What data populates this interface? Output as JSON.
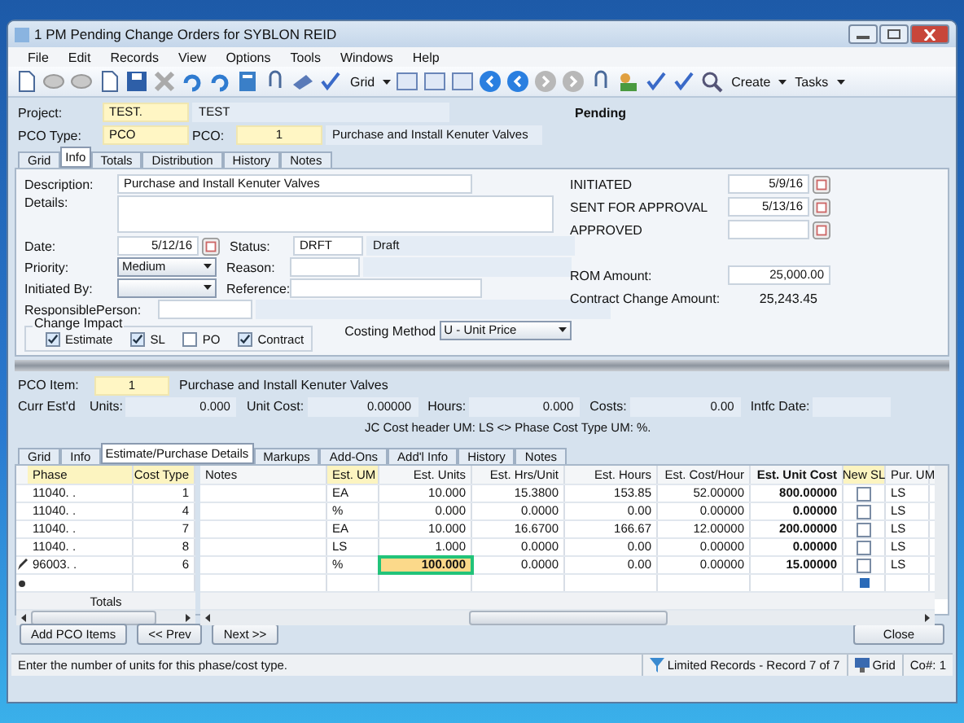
{
  "window": {
    "title": "1 PM Pending Change Orders for SYBLON REID"
  },
  "menu": [
    "File",
    "Edit",
    "Records",
    "View",
    "Options",
    "Tools",
    "Windows",
    "Help"
  ],
  "toolbar": {
    "grid_label": "Grid",
    "create_label": "Create",
    "tasks_label": "Tasks"
  },
  "header": {
    "project_label": "Project:",
    "project_code": "TEST.",
    "project_name": "TEST",
    "status": "Pending",
    "pco_type_label": "PCO Type:",
    "pco_type": "PCO",
    "pco_label": "PCO:",
    "pco": "1",
    "pco_description": "Purchase and Install Kenuter Valves"
  },
  "top_tabs": [
    {
      "label": "Grid",
      "selected": false
    },
    {
      "label": "Info",
      "selected": true
    },
    {
      "label": "Totals",
      "selected": false
    },
    {
      "label": "Distribution",
      "selected": false
    },
    {
      "label": "History",
      "selected": false
    },
    {
      "label": "Notes",
      "selected": false
    }
  ],
  "info": {
    "description_label": "Description:",
    "description": "Purchase and Install Kenuter Valves",
    "details_label": "Details:",
    "date_label": "Date:",
    "date": "5/12/16",
    "status_label": "Status:",
    "status_code": "DRFT",
    "status_name": "Draft",
    "priority_label": "Priority:",
    "priority": "Medium",
    "reason_label": "Reason:",
    "initiated_by_label": "Initiated By:",
    "reference_label": "Reference:",
    "responsible_label": "ResponsiblePerson:",
    "change_impact_label": "Change Impact",
    "change_impact": [
      {
        "label": "Estimate",
        "checked": true
      },
      {
        "label": "SL",
        "checked": true
      },
      {
        "label": "PO",
        "checked": false
      },
      {
        "label": "Contract",
        "checked": true
      }
    ],
    "costing_method_label": "Costing Method",
    "costing_method": "U - Unit Price",
    "dates": [
      {
        "label": "INITIATED",
        "value": "5/9/16"
      },
      {
        "label": "SENT FOR APPROVAL",
        "value": "5/13/16"
      },
      {
        "label": "APPROVED"
      }
    ],
    "rom_label": "ROM Amount:",
    "rom": "25,000.00",
    "contract_change_label": "Contract Change Amount:",
    "contract_change": "25,243.45"
  },
  "item": {
    "label": "PCO Item:",
    "number": "1",
    "description": "Purchase and Install Kenuter Valves",
    "curr_label": "Curr Est'd",
    "units_label": "Units:",
    "units": "0.000",
    "unit_cost_label": "Unit Cost:",
    "unit_cost": "0.00000",
    "hours_label": "Hours:",
    "hours": "0.000",
    "costs_label": "Costs:",
    "costs": "0.00",
    "intfc_label": "Intfc Date:",
    "warning": "JC Cost header UM: LS <> Phase Cost Type UM: %."
  },
  "lower_tabs": [
    {
      "label": "Grid",
      "selected": false
    },
    {
      "label": "Info",
      "selected": false
    },
    {
      "label": "Estimate/Purchase Details",
      "selected": true
    },
    {
      "label": "Markups",
      "selected": false
    },
    {
      "label": "Add-Ons",
      "selected": false
    },
    {
      "label": "Add'l Info",
      "selected": false
    },
    {
      "label": "History",
      "selected": false
    },
    {
      "label": "Notes",
      "selected": false
    }
  ],
  "grid": {
    "left_columns": [
      "Phase",
      "Cost Type"
    ],
    "right_columns": [
      "Notes",
      "Est. UM",
      "Est. Units",
      "Est. Hrs/Unit",
      "Est. Hours",
      "Est. Cost/Hour",
      "Est. Unit Cost",
      "New SL",
      "Pur. UM"
    ],
    "totals_label": "Totals",
    "rows": [
      {
        "phase": "11040.   .",
        "cost_type": "1",
        "um": "EA",
        "units": "10.000",
        "hrs_unit": "15.3800",
        "hours": "153.85",
        "cost_hour": "52.00000",
        "unit_cost": "800.00000",
        "new_sl": false,
        "pur_um": "LS",
        "selected": false
      },
      {
        "phase": "11040.   .",
        "cost_type": "4",
        "um": "%",
        "units": "0.000",
        "hrs_unit": "0.0000",
        "hours": "0.00",
        "cost_hour": "0.00000",
        "unit_cost": "0.00000",
        "new_sl": false,
        "pur_um": "LS",
        "selected": false
      },
      {
        "phase": "11040.   .",
        "cost_type": "7",
        "um": "EA",
        "units": "10.000",
        "hrs_unit": "16.6700",
        "hours": "166.67",
        "cost_hour": "12.00000",
        "unit_cost": "200.00000",
        "new_sl": false,
        "pur_um": "LS",
        "selected": false
      },
      {
        "phase": "11040.   .",
        "cost_type": "8",
        "um": "LS",
        "units": "1.000",
        "hrs_unit": "0.0000",
        "hours": "0.00",
        "cost_hour": "0.00000",
        "unit_cost": "0.00000",
        "new_sl": false,
        "pur_um": "LS",
        "selected": false
      },
      {
        "phase": "96003.   .",
        "cost_type": "6",
        "um": "%",
        "units": "100.000",
        "hrs_unit": "0.0000",
        "hours": "0.00",
        "cost_hour": "0.00000",
        "unit_cost": "15.00000",
        "new_sl": false,
        "pur_um": "LS",
        "selected": true
      }
    ]
  },
  "buttons": {
    "add": "Add PCO Items",
    "prev": "<< Prev",
    "next": "Next >>",
    "close": "Close"
  },
  "status_bar": {
    "message": "Enter the number of units for this phase/cost type.",
    "records": "Limited Records - Record 7 of 7",
    "view": "Grid",
    "company": "Co#: 1"
  }
}
